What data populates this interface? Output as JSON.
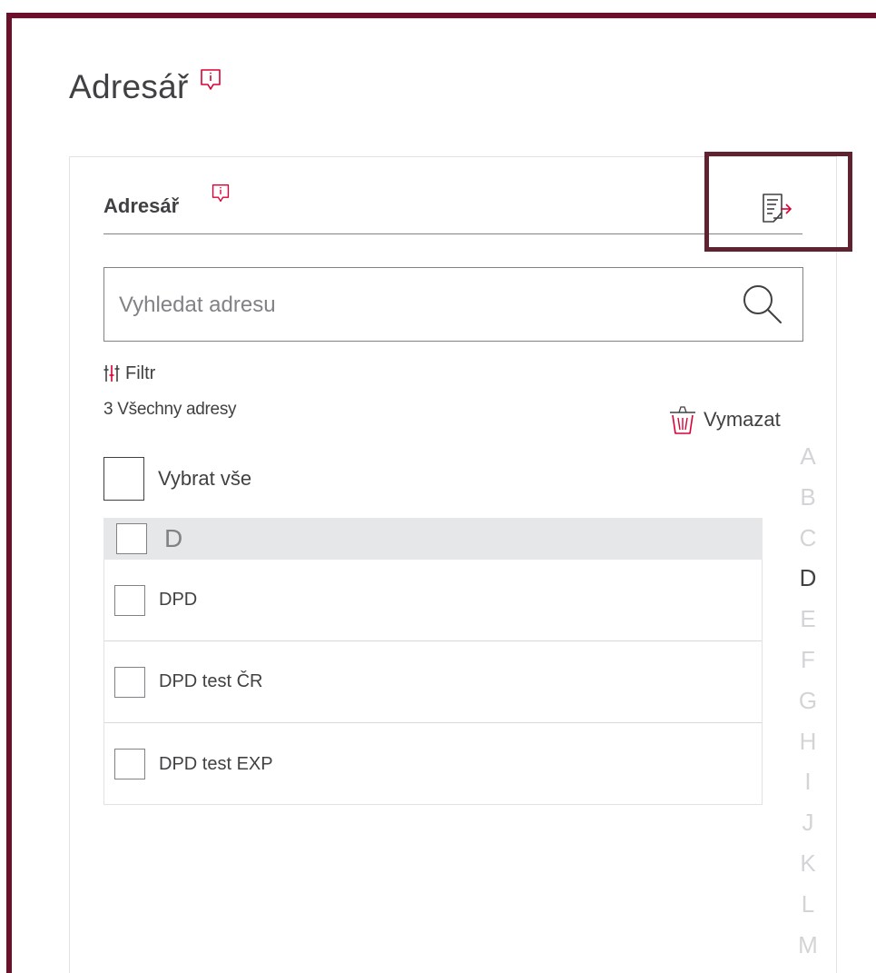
{
  "page": {
    "title": "Adresář"
  },
  "card": {
    "title": "Adresář"
  },
  "search": {
    "placeholder": "Vyhledat adresu",
    "value": ""
  },
  "filter": {
    "label": "Filtr"
  },
  "addresses": {
    "count_label": "3 Všechny adresy",
    "delete_label": "Vymazat",
    "select_all_label": "Vybrat vše"
  },
  "groups": [
    {
      "letter": "D",
      "items": [
        {
          "label": "DPD"
        },
        {
          "label": "DPD test ČR"
        },
        {
          "label": "DPD test EXP"
        }
      ]
    }
  ],
  "alphabet": {
    "letters": [
      "A",
      "B",
      "C",
      "D",
      "E",
      "F",
      "G",
      "H",
      "I",
      "J",
      "K",
      "L",
      "M"
    ],
    "active": "D"
  },
  "icons": {
    "info": "info-bubble-icon",
    "export": "export-document-icon",
    "search": "search-icon",
    "filter": "sliders-icon",
    "delete": "trash-icon"
  },
  "colors": {
    "frame": "#6b0f2b",
    "highlight": "#5e2230",
    "accent": "#dc0032",
    "text": "#414042",
    "muted": "#808285",
    "group_bg": "#e6e7e8",
    "alphabet_inactive": "#d3d4d5"
  }
}
